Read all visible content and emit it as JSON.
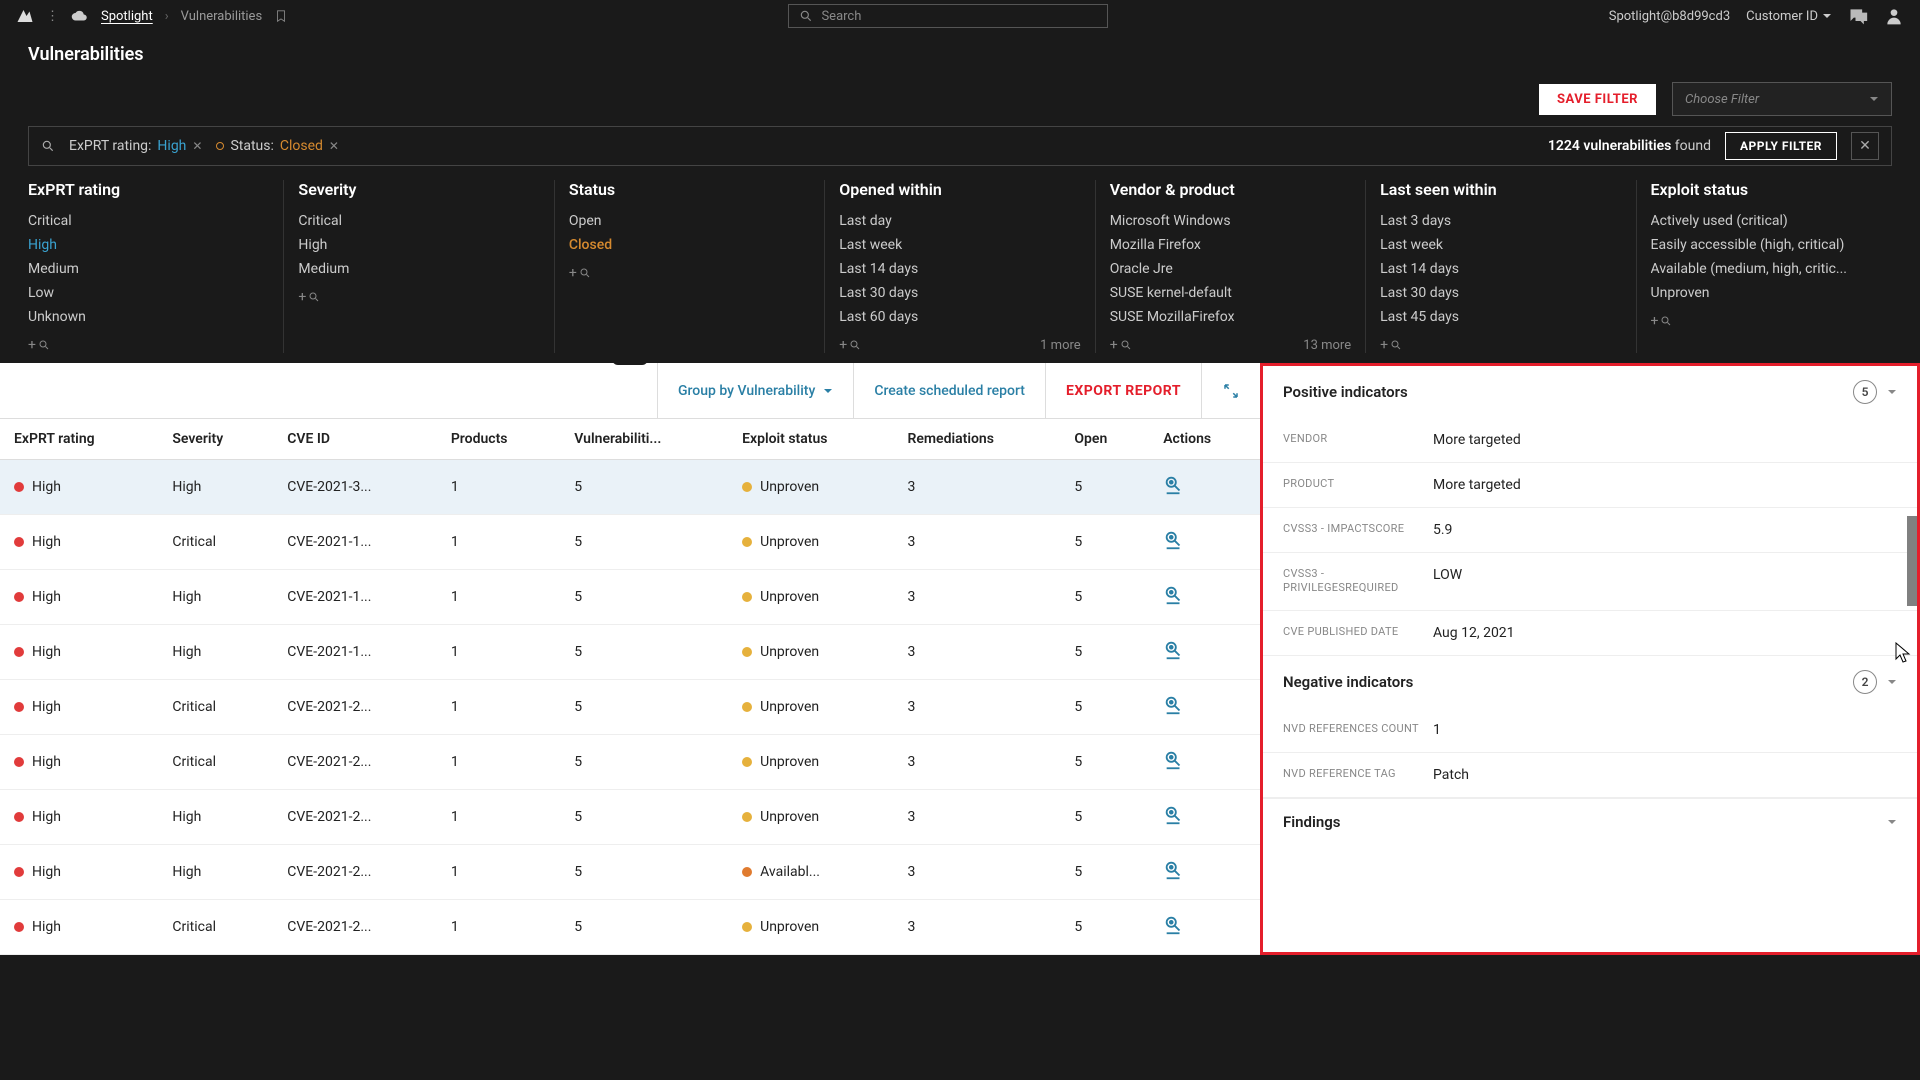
{
  "topbar": {
    "breadcrumb1": "Spotlight",
    "breadcrumb2": "Vulnerabilities",
    "search_placeholder": "Search",
    "user": "Spotlight@b8d99cd3",
    "customer_label": "Customer ID"
  },
  "page_title": "Vulnerabilities",
  "filter_actions": {
    "save": "SAVE FILTER",
    "choose_placeholder": "Choose Filter"
  },
  "chips": {
    "c1_label": "ExPRT rating:",
    "c1_value": "High",
    "c2_label": "Status:",
    "c2_value": "Closed",
    "count_num": "1224 vulnerabilities",
    "count_suffix": " found",
    "apply": "APPLY FILTER"
  },
  "facets": [
    {
      "title": "ExPRT rating",
      "opts": [
        "Critical",
        "High",
        "Medium",
        "Low",
        "Unknown"
      ],
      "active_idx": 1,
      "active_class": "active-blue",
      "more": ""
    },
    {
      "title": "Severity",
      "opts": [
        "Critical",
        "High",
        "Medium"
      ],
      "more": ""
    },
    {
      "title": "Status",
      "opts": [
        "Open",
        "Closed"
      ],
      "active_idx": 1,
      "active_class": "active-orange",
      "more": ""
    },
    {
      "title": "Opened within",
      "opts": [
        "Last day",
        "Last week",
        "Last 14 days",
        "Last 30 days",
        "Last 60 days"
      ],
      "more": "1 more"
    },
    {
      "title": "Vendor & product",
      "opts": [
        "Microsoft Windows",
        "Mozilla Firefox",
        "Oracle Jre",
        "SUSE kernel-default",
        "SUSE MozillaFirefox"
      ],
      "more": "13 more"
    },
    {
      "title": "Last seen within",
      "opts": [
        "Last 3 days",
        "Last week",
        "Last 14 days",
        "Last 30 days",
        "Last 45 days"
      ],
      "more": ""
    },
    {
      "title": "Exploit status",
      "opts": [
        "Actively used (critical)",
        "Easily accessible (high, critical)",
        "Available (medium, high, critic...",
        "Unproven"
      ],
      "more": ""
    }
  ],
  "tools": {
    "group": "Group by Vulnerability",
    "schedule": "Create scheduled report",
    "export": "EXPORT REPORT"
  },
  "columns": [
    "ExPRT rating",
    "Severity",
    "CVE ID",
    "Products",
    "Vulnerabiliti...",
    "Exploit status",
    "Remediations",
    "Open",
    "Actions"
  ],
  "rows": [
    {
      "exprt": "High",
      "sev": "High",
      "cve": "CVE-2021-3...",
      "prod": "1",
      "vuln": "5",
      "expl": "Unproven",
      "expl_dot": "dot-yellow",
      "rem": "3",
      "open": "5",
      "selected": true
    },
    {
      "exprt": "High",
      "sev": "Critical",
      "cve": "CVE-2021-1...",
      "prod": "1",
      "vuln": "5",
      "expl": "Unproven",
      "expl_dot": "dot-yellow",
      "rem": "3",
      "open": "5"
    },
    {
      "exprt": "High",
      "sev": "High",
      "cve": "CVE-2021-1...",
      "prod": "1",
      "vuln": "5",
      "expl": "Unproven",
      "expl_dot": "dot-yellow",
      "rem": "3",
      "open": "5"
    },
    {
      "exprt": "High",
      "sev": "High",
      "cve": "CVE-2021-1...",
      "prod": "1",
      "vuln": "5",
      "expl": "Unproven",
      "expl_dot": "dot-yellow",
      "rem": "3",
      "open": "5"
    },
    {
      "exprt": "High",
      "sev": "Critical",
      "cve": "CVE-2021-2...",
      "prod": "1",
      "vuln": "5",
      "expl": "Unproven",
      "expl_dot": "dot-yellow",
      "rem": "3",
      "open": "5"
    },
    {
      "exprt": "High",
      "sev": "Critical",
      "cve": "CVE-2021-2...",
      "prod": "1",
      "vuln": "5",
      "expl": "Unproven",
      "expl_dot": "dot-yellow",
      "rem": "3",
      "open": "5"
    },
    {
      "exprt": "High",
      "sev": "High",
      "cve": "CVE-2021-2...",
      "prod": "1",
      "vuln": "5",
      "expl": "Unproven",
      "expl_dot": "dot-yellow",
      "rem": "3",
      "open": "5"
    },
    {
      "exprt": "High",
      "sev": "High",
      "cve": "CVE-2021-2...",
      "prod": "1",
      "vuln": "5",
      "expl": "Availabl...",
      "expl_dot": "dot-orange2",
      "rem": "3",
      "open": "5"
    },
    {
      "exprt": "High",
      "sev": "Critical",
      "cve": "CVE-2021-2...",
      "prod": "1",
      "vuln": "5",
      "expl": "Unproven",
      "expl_dot": "dot-yellow",
      "rem": "3",
      "open": "5"
    }
  ],
  "panel": {
    "sect1_title": "Positive indicators",
    "sect1_count": "5",
    "kv": [
      {
        "k": "VENDOR",
        "v": "More targeted"
      },
      {
        "k": "PRODUCT",
        "v": "More targeted"
      },
      {
        "k": "CVSS3 - IMPACTSCORE",
        "v": "5.9"
      },
      {
        "k": "CVSS3 - PRIVILEGESREQUIRED",
        "v": "LOW"
      },
      {
        "k": "CVE PUBLISHED DATE",
        "v": "Aug 12, 2021"
      }
    ],
    "sect2_title": "Negative indicators",
    "sect2_count": "2",
    "kv2": [
      {
        "k": "NVD REFERENCES COUNT",
        "v": "1"
      },
      {
        "k": "NVD REFERENCE TAG",
        "v": "Patch"
      }
    ],
    "sect3_title": "Findings"
  }
}
